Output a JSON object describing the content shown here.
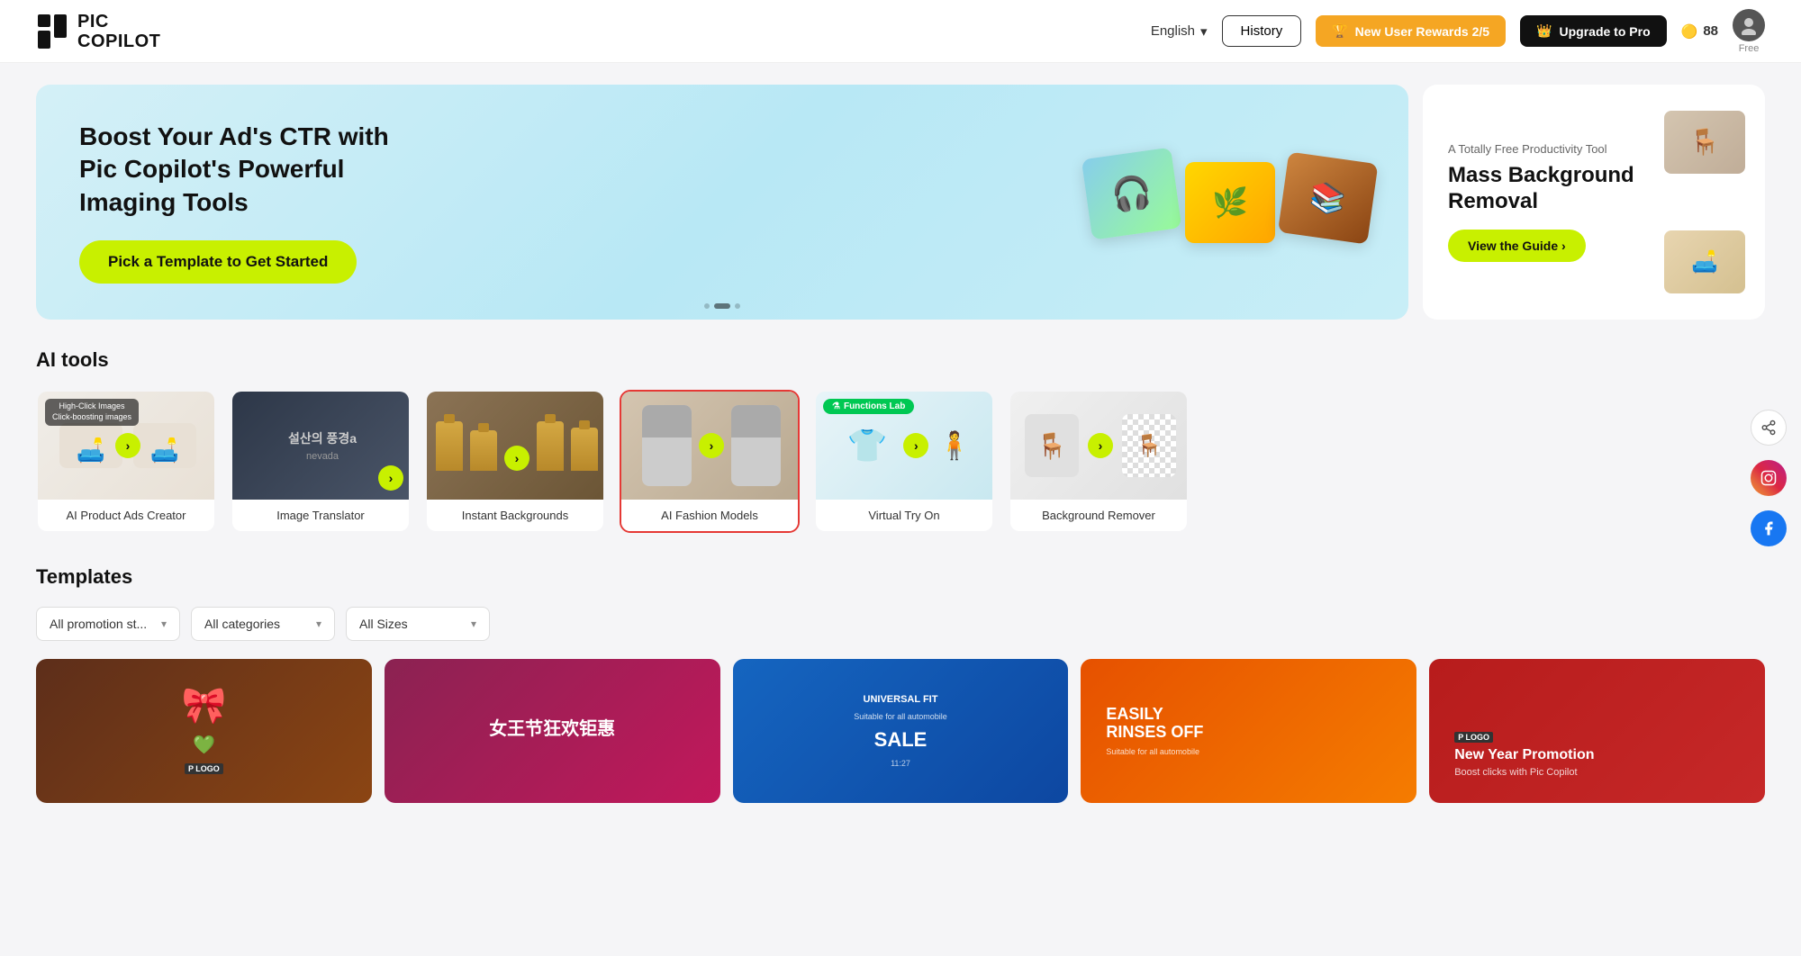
{
  "header": {
    "logo_line1": "PIC",
    "logo_line2": "COPILOT",
    "lang_label": "English",
    "history_label": "History",
    "rewards_label": "New User Rewards 2/5",
    "upgrade_label": "Upgrade to Pro",
    "coins_count": "88",
    "avatar_label": "Free"
  },
  "banner": {
    "main_heading": "Boost Your Ad's CTR with Pic Copilot's Powerful Imaging Tools",
    "cta_label": "Pick a Template to Get Started",
    "side_label": "A Totally Free Productivity Tool",
    "side_heading_line1": "Mass Background",
    "side_heading_line2": "Removal",
    "side_cta": "View the Guide ›"
  },
  "ai_tools": {
    "section_title": "AI tools",
    "items": [
      {
        "id": "product-ads",
        "label": "AI Product Ads Creator",
        "badge": "High-Click Images\nClick-boosting images"
      },
      {
        "id": "image-translator",
        "label": "Image Translator",
        "badge": null
      },
      {
        "id": "instant-backgrounds",
        "label": "Instant Backgrounds",
        "badge": null
      },
      {
        "id": "fashion-models",
        "label": "AI Fashion Models",
        "badge": null,
        "selected": true
      },
      {
        "id": "virtual-try-on",
        "label": "Virtual Try On",
        "badge": "Functions Lab"
      },
      {
        "id": "background-remover",
        "label": "Background Remover",
        "badge": null
      }
    ]
  },
  "templates": {
    "section_title": "Templates",
    "filters": [
      {
        "id": "promotion",
        "label": "All promotion st..."
      },
      {
        "id": "categories",
        "label": "All categories"
      },
      {
        "id": "sizes",
        "label": "All Sizes"
      }
    ],
    "items": [
      {
        "id": "tpl-1",
        "logo": "LOGO",
        "title": "",
        "sub": "",
        "bg": "brown"
      },
      {
        "id": "tpl-2",
        "logo": "",
        "title": "女王节狂欢钜惠",
        "sub": "",
        "bg": "pink"
      },
      {
        "id": "tpl-3",
        "logo": "",
        "title": "UNIVERSAL FIT",
        "sub": "Suitable for all automobile\nSALE",
        "bg": "blue"
      },
      {
        "id": "tpl-4",
        "logo": "",
        "title": "EASILY RINSES OFF",
        "sub": "Suitable for all automobile",
        "bg": "orange"
      },
      {
        "id": "tpl-5",
        "logo": "LOGO",
        "title": "New Year Promotion",
        "sub": "Boost clicks with Pic Copilot",
        "bg": "red"
      }
    ]
  },
  "social": {
    "share_icon": "share",
    "instagram_icon": "instagram",
    "facebook_icon": "facebook"
  }
}
